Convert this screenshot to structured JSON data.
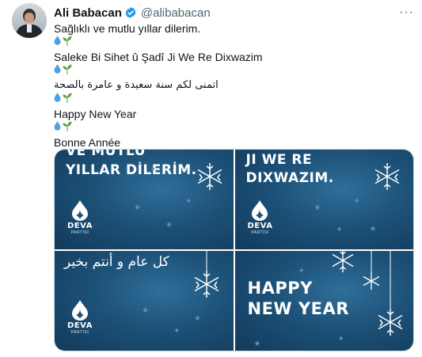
{
  "tweet": {
    "author_name": "Ali Babacan",
    "author_handle": "@alibabacan",
    "lines": [
      "Sağlıklı ve mutlu yıllar dilerim.",
      "Saleke Bi Sihet û Şadî Ji We Re Dixwazim",
      "اتمنى لكم سنة سعيدة و عامرة بالصحة",
      "Happy New Year",
      "Bonne Année"
    ],
    "emoji": [
      "droplet-emoji",
      "seedling-emoji"
    ]
  },
  "images": [
    {
      "text_lines": [
        "VE MUTLU",
        "YILLAR DİLERİM."
      ],
      "logo_word": "DEVA",
      "logo_sub": "PARTİSİ"
    },
    {
      "text_lines": [
        "JI WE RE",
        "DIXWAZIM."
      ],
      "logo_word": "DEVA",
      "logo_sub": "PARTİSİ"
    },
    {
      "text_lines": [
        "كل عام و أنتم بخير"
      ],
      "logo_word": "DEVA",
      "logo_sub": "PARTİSİ"
    },
    {
      "text_lines": [
        "HAPPY",
        "NEW YEAR"
      ]
    }
  ],
  "colors": {
    "verified": "#1d9bf0",
    "drop": "#4aa3df",
    "sprout": "#5ba33b",
    "image_bg": "#1d5178"
  }
}
